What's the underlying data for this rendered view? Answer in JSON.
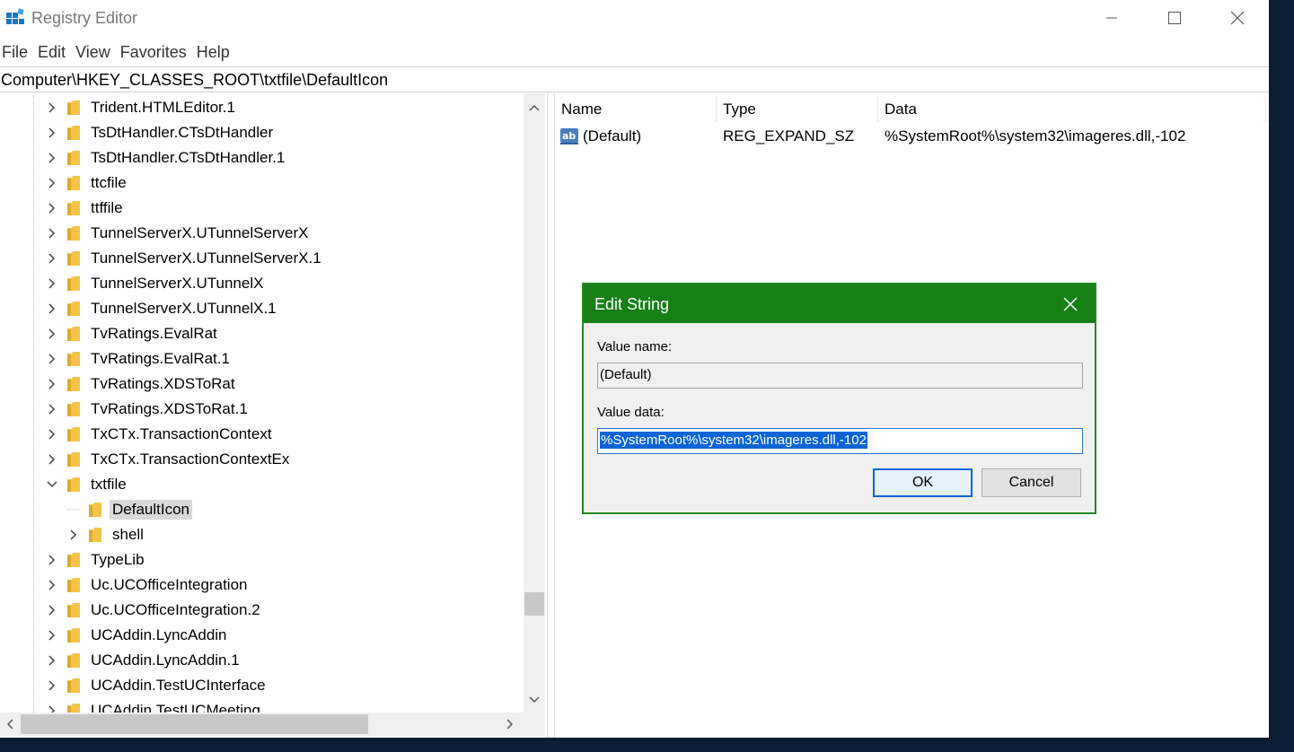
{
  "window": {
    "title": "Registry Editor",
    "icon": "registry-editor-icon"
  },
  "menu": [
    "File",
    "Edit",
    "View",
    "Favorites",
    "Help"
  ],
  "address": "Computer\\HKEY_CLASSES_ROOT\\txtfile\\DefaultIcon",
  "tree": {
    "items": [
      {
        "label": "Trident.HTMLEditor.1",
        "level": 0,
        "expander": "collapsed"
      },
      {
        "label": "TsDtHandler.CTsDtHandler",
        "level": 0,
        "expander": "collapsed"
      },
      {
        "label": "TsDtHandler.CTsDtHandler.1",
        "level": 0,
        "expander": "collapsed"
      },
      {
        "label": "ttcfile",
        "level": 0,
        "expander": "collapsed"
      },
      {
        "label": "ttffile",
        "level": 0,
        "expander": "collapsed"
      },
      {
        "label": "TunnelServerX.UTunnelServerX",
        "level": 0,
        "expander": "collapsed"
      },
      {
        "label": "TunnelServerX.UTunnelServerX.1",
        "level": 0,
        "expander": "collapsed"
      },
      {
        "label": "TunnelServerX.UTunnelX",
        "level": 0,
        "expander": "collapsed"
      },
      {
        "label": "TunnelServerX.UTunnelX.1",
        "level": 0,
        "expander": "collapsed"
      },
      {
        "label": "TvRatings.EvalRat",
        "level": 0,
        "expander": "collapsed"
      },
      {
        "label": "TvRatings.EvalRat.1",
        "level": 0,
        "expander": "collapsed"
      },
      {
        "label": "TvRatings.XDSToRat",
        "level": 0,
        "expander": "collapsed"
      },
      {
        "label": "TvRatings.XDSToRat.1",
        "level": 0,
        "expander": "collapsed"
      },
      {
        "label": "TxCTx.TransactionContext",
        "level": 0,
        "expander": "collapsed"
      },
      {
        "label": "TxCTx.TransactionContextEx",
        "level": 0,
        "expander": "collapsed"
      },
      {
        "label": "txtfile",
        "level": 0,
        "expander": "expanded"
      },
      {
        "label": "DefaultIcon",
        "level": 1,
        "expander": "none",
        "selected": true
      },
      {
        "label": "shell",
        "level": 1,
        "expander": "collapsed"
      },
      {
        "label": "TypeLib",
        "level": 0,
        "expander": "collapsed"
      },
      {
        "label": "Uc.UCOfficeIntegration",
        "level": 0,
        "expander": "collapsed"
      },
      {
        "label": "Uc.UCOfficeIntegration.2",
        "level": 0,
        "expander": "collapsed"
      },
      {
        "label": "UCAddin.LyncAddin",
        "level": 0,
        "expander": "collapsed"
      },
      {
        "label": "UCAddin.LyncAddin.1",
        "level": 0,
        "expander": "collapsed"
      },
      {
        "label": "UCAddin.TestUCInterface",
        "level": 0,
        "expander": "collapsed"
      },
      {
        "label": "UCAddin.TestUCMeeting",
        "level": 0,
        "expander": "collapsed"
      }
    ]
  },
  "values": {
    "columns": {
      "name": "Name",
      "type": "Type",
      "data": "Data"
    },
    "rows": [
      {
        "name": "(Default)",
        "type": "REG_EXPAND_SZ",
        "data": "%SystemRoot%\\system32\\imageres.dll,-102",
        "icon": "string-value-icon"
      }
    ]
  },
  "dialog": {
    "title": "Edit String",
    "value_name_label": "Value name:",
    "value_name": "(Default)",
    "value_data_label": "Value data:",
    "value_data": "%SystemRoot%\\system32\\imageres.dll,-102",
    "ok_label": "OK",
    "cancel_label": "Cancel"
  },
  "colors": {
    "dialog_title_bar": "#168017",
    "selection": "#0a64d6",
    "folder": "#f3c34a",
    "desktop": "#0b1e34"
  }
}
